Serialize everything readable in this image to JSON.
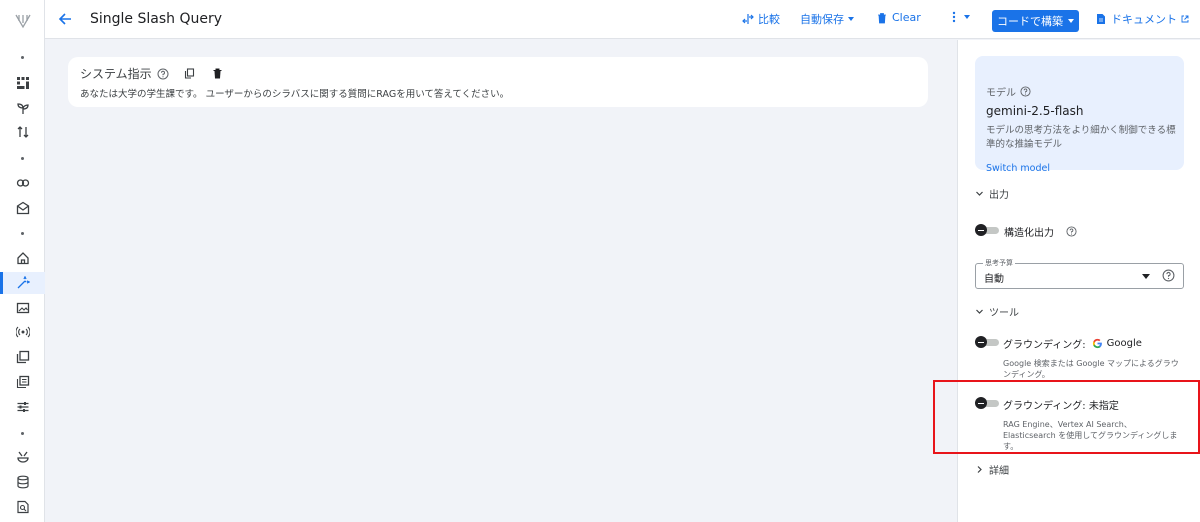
{
  "topbar": {
    "title": "Single Slash Query",
    "compare": "比較",
    "autosave": "自動保存",
    "clear": "Clear",
    "build": "コードで構築",
    "docs": "ドキュメント"
  },
  "system": {
    "label": "システム指示",
    "text": "あなたは大学の学生課です。 ユーザーからのシラバスに関する質問にRAGを用いて答えてください。"
  },
  "model": {
    "label": "モデル",
    "name": "gemini-2.5-flash",
    "description": "モデルの思考方法をより細かく制御できる標準的な推論モデル",
    "switch": "Switch model"
  },
  "sections": {
    "output": "出力",
    "tools": "ツール",
    "details": "詳細"
  },
  "structured_output": {
    "label": "構造化出力"
  },
  "thinking_budget": {
    "label": "思考予算",
    "value": "自動"
  },
  "grounding_google": {
    "label": "グラウンディング:",
    "provider": "Google",
    "desc": "Google 検索または Google マップによるグラウンディング。"
  },
  "grounding_custom": {
    "label": "グラウンディング: 未指定",
    "desc": "RAG Engine、Vertex AI Search、Elasticsearch を使用してグラウンディングします。"
  },
  "colors": {
    "accent": "#1a73e8",
    "highlight": "#e8141a",
    "model_card_bg": "#e8f0fe"
  }
}
